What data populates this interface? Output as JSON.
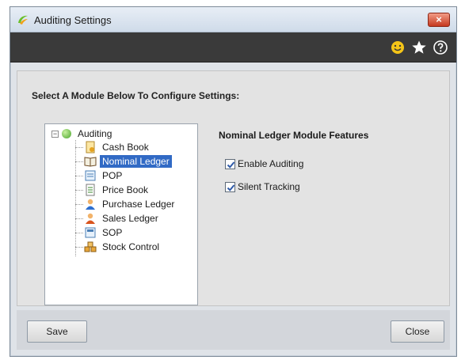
{
  "window": {
    "title": "Auditing Settings",
    "close_glyph": "×"
  },
  "toolbar": {
    "icons": [
      "smiley-icon",
      "star-icon",
      "help-icon"
    ]
  },
  "main": {
    "heading": "Select A Module Below To Configure Settings:",
    "tree": {
      "root_label": "Auditing",
      "expander_glyph": "−",
      "items": [
        {
          "label": "Cash Book",
          "icon": "cash-book-icon"
        },
        {
          "label": "Nominal Ledger",
          "icon": "nominal-ledger-icon",
          "selected": true
        },
        {
          "label": "POP",
          "icon": "pop-icon"
        },
        {
          "label": "Price Book",
          "icon": "price-book-icon"
        },
        {
          "label": "Purchase Ledger",
          "icon": "purchase-ledger-icon"
        },
        {
          "label": "Sales Ledger",
          "icon": "sales-ledger-icon"
        },
        {
          "label": "SOP",
          "icon": "sop-icon"
        },
        {
          "label": "Stock Control",
          "icon": "stock-control-icon"
        }
      ]
    },
    "features": {
      "title": "Nominal Ledger Module Features",
      "options": [
        {
          "label": "Enable Auditing",
          "checked": true
        },
        {
          "label": "Silent Tracking",
          "checked": true
        }
      ]
    }
  },
  "footer": {
    "save_label": "Save",
    "close_label": "Close"
  },
  "colors": {
    "selection": "#316ac5",
    "toolbar_bg": "#3a3a3a",
    "close_red": "#c5391f"
  }
}
